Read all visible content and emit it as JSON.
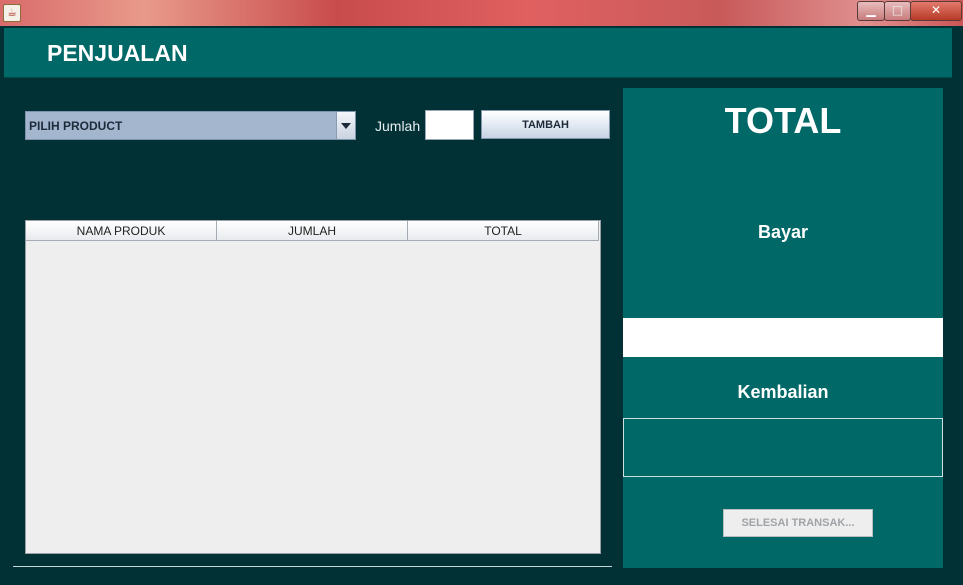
{
  "window": {
    "minimize_glyph": "▁",
    "maximize_glyph": "□",
    "close_glyph": "✕",
    "app_icon_glyph": "☕"
  },
  "header": {
    "title": "PENJUALAN"
  },
  "form": {
    "product_select_value": "PILIH PRODUCT",
    "jumlah_label": "Jumlah",
    "jumlah_value": "",
    "tambah_label": "TAMBAH"
  },
  "table": {
    "columns": [
      "NAMA PRODUK",
      "JUMLAH",
      "TOTAL"
    ],
    "rows": []
  },
  "summary": {
    "total_label": "TOTAL",
    "bayar_label": "Bayar",
    "bayar_value": "",
    "kembalian_label": "Kembalian",
    "kembalian_value": "",
    "selesai_label": "SELESAI TRANSAK..."
  },
  "colors": {
    "frame_bg": "#013035",
    "header_bg": "#006866",
    "panel_bg": "#006866"
  }
}
